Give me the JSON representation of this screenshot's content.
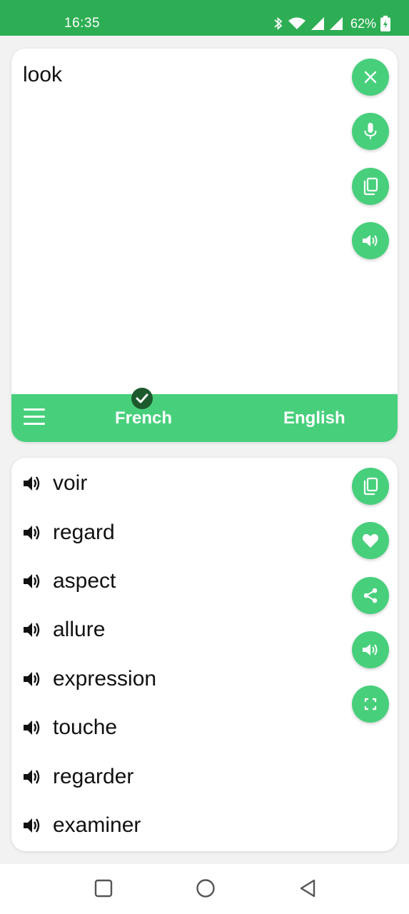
{
  "status_bar": {
    "time": "16:35",
    "battery": "62%"
  },
  "input": {
    "text": "look"
  },
  "language_bar": {
    "source": "French",
    "target": "English"
  },
  "results": [
    {
      "word": "voir"
    },
    {
      "word": "regard"
    },
    {
      "word": "aspect"
    },
    {
      "word": "allure"
    },
    {
      "word": "expression"
    },
    {
      "word": "touche"
    },
    {
      "word": "regarder"
    },
    {
      "word": "examiner"
    }
  ],
  "colors": {
    "status_green": "#2eae54",
    "accent_green": "#48cf7c",
    "badge_dark_green": "#1c5a2e"
  },
  "icons": {
    "input_actions": [
      "close-icon",
      "microphone-icon",
      "copy-icon",
      "speaker-icon"
    ],
    "result_actions": [
      "copy-icon",
      "heart-icon",
      "share-icon",
      "speaker-icon",
      "fullscreen-icon"
    ],
    "nav": [
      "recents-icon",
      "home-icon",
      "back-icon"
    ]
  }
}
